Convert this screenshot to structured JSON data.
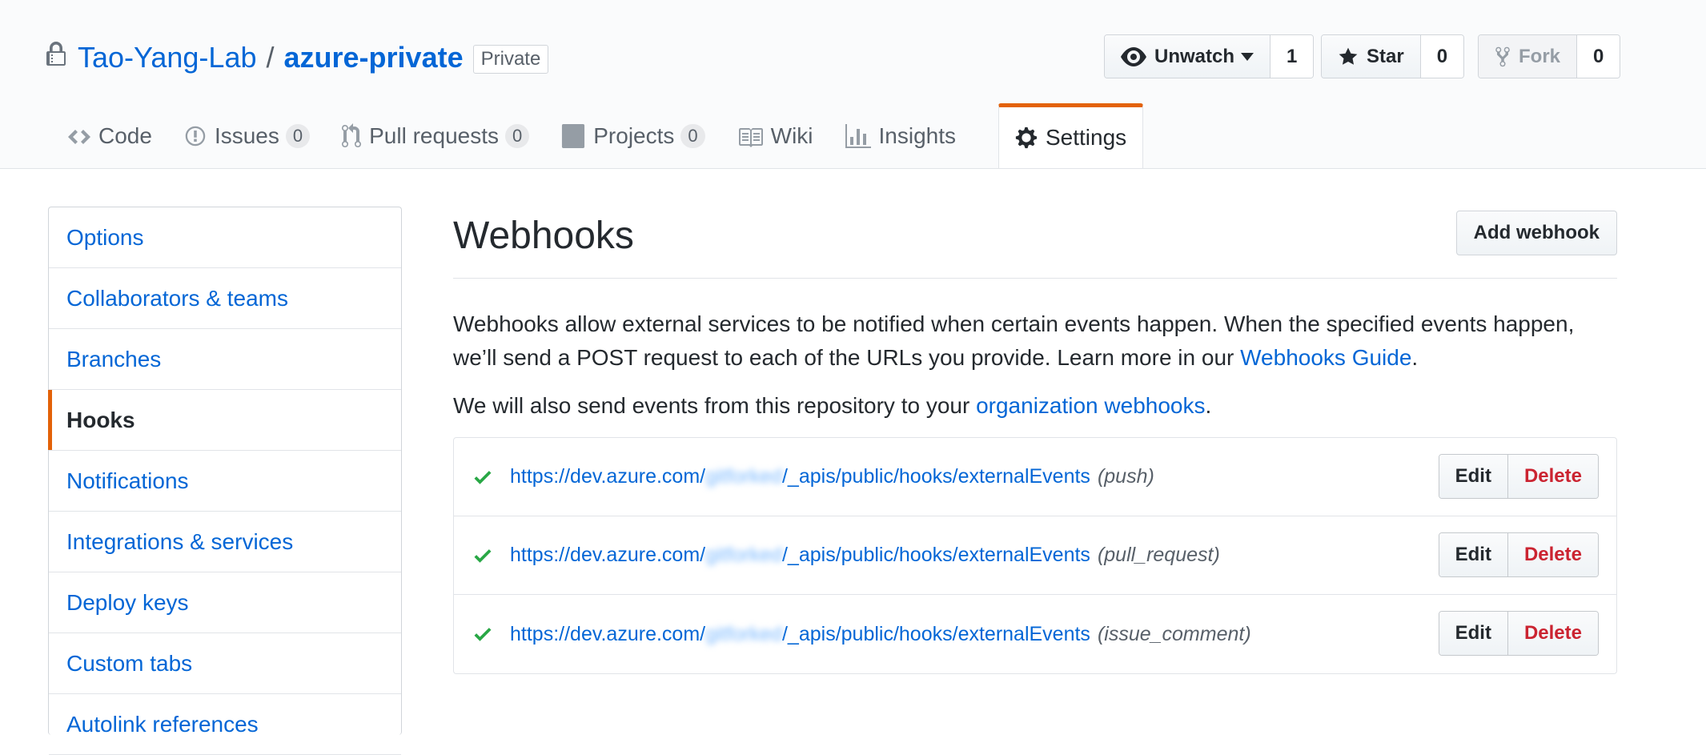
{
  "repo": {
    "owner": "Tao-Yang-Lab",
    "separator": "/",
    "name": "azure-private",
    "visibility_label": "Private"
  },
  "actions": {
    "watch_label": "Unwatch",
    "watch_count": "1",
    "star_label": "Star",
    "star_count": "0",
    "fork_label": "Fork",
    "fork_count": "0"
  },
  "tabs": [
    {
      "label": "Code",
      "icon": "code-icon",
      "count": null
    },
    {
      "label": "Issues",
      "icon": "issue-icon",
      "count": "0"
    },
    {
      "label": "Pull requests",
      "icon": "pull-request-icon",
      "count": "0"
    },
    {
      "label": "Projects",
      "icon": "project-icon",
      "count": "0"
    },
    {
      "label": "Wiki",
      "icon": "book-icon",
      "count": null
    },
    {
      "label": "Insights",
      "icon": "graph-icon",
      "count": null
    },
    {
      "label": "Settings",
      "icon": "gear-icon",
      "count": null,
      "selected": true
    }
  ],
  "sidebar": {
    "items": [
      {
        "label": "Options"
      },
      {
        "label": "Collaborators & teams"
      },
      {
        "label": "Branches"
      },
      {
        "label": "Hooks",
        "selected": true
      },
      {
        "label": "Notifications"
      },
      {
        "label": "Integrations & services"
      },
      {
        "label": "Deploy keys"
      },
      {
        "label": "Custom tabs"
      },
      {
        "label": "Autolink references"
      }
    ]
  },
  "main": {
    "title": "Webhooks",
    "add_button": "Add webhook",
    "desc_text": "Webhooks allow external services to be notified when certain events happen. When the specified events happen, we’ll send a POST request to each of the URLs you provide. Learn more in our ",
    "desc_link": "Webhooks Guide",
    "desc_end": ".",
    "desc2_text": "We will also send events from this repository to your ",
    "desc2_link": "organization webhooks",
    "desc2_end": ".",
    "hooks": [
      {
        "url_prefix": "https://dev.azure.com/",
        "url_blurred": "gitforked",
        "url_suffix": "/_apis/public/hooks/externalEvents",
        "event": "(push)",
        "edit": "Edit",
        "delete": "Delete"
      },
      {
        "url_prefix": "https://dev.azure.com/",
        "url_blurred": "gitforked",
        "url_suffix": "/_apis/public/hooks/externalEvents",
        "event": "(pull_request)",
        "edit": "Edit",
        "delete": "Delete"
      },
      {
        "url_prefix": "https://dev.azure.com/",
        "url_blurred": "gitforked",
        "url_suffix": "/_apis/public/hooks/externalEvents",
        "event": "(issue_comment)",
        "edit": "Edit",
        "delete": "Delete"
      }
    ]
  },
  "colors": {
    "link": "#0366d6",
    "accent": "#e36209",
    "success": "#28a745",
    "danger": "#cb2431"
  }
}
